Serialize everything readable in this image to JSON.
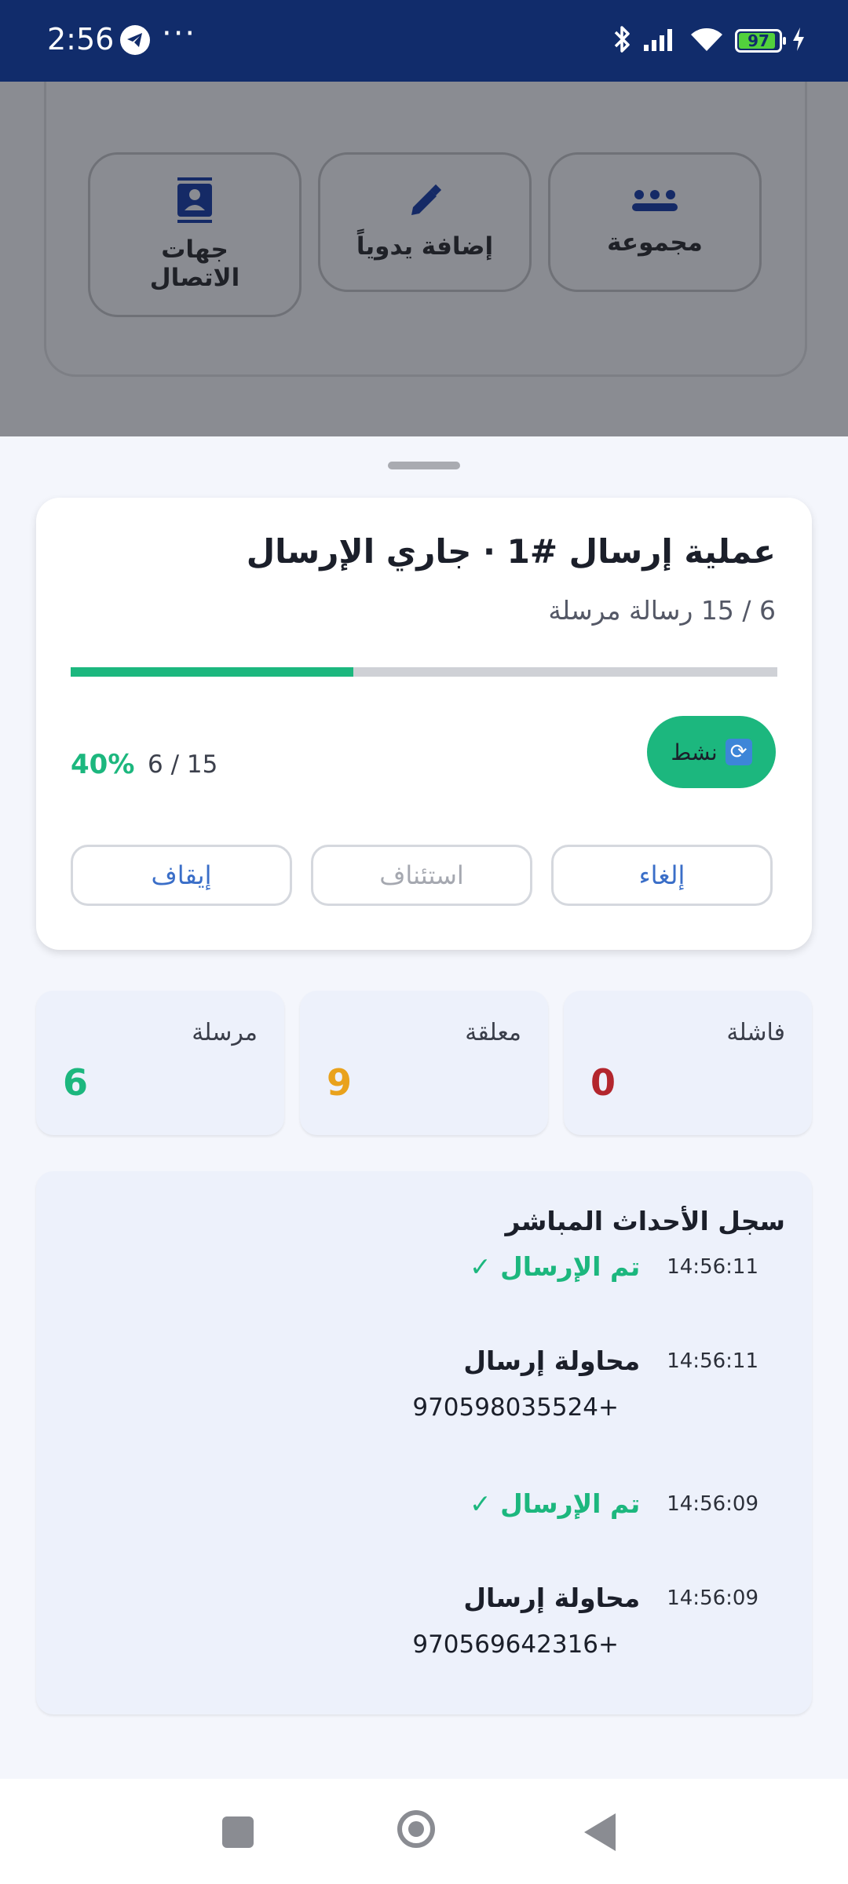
{
  "status_bar": {
    "time": "2:56",
    "more": "···",
    "battery_level": "97",
    "icons": [
      "telegram-icon",
      "bluetooth-icon",
      "signal-icon",
      "wifi-icon",
      "battery-icon",
      "charging-icon"
    ]
  },
  "background": {
    "buttons": [
      {
        "label": "مجموعة",
        "icon": "group-icon"
      },
      {
        "label": "إضافة يدوياً",
        "icon": "pencil-icon"
      },
      {
        "label": "جهات الاتصال",
        "icon": "contacts-icon"
      }
    ]
  },
  "operation": {
    "title": "عملية إرسال #1 · جاري الإرسال",
    "subtitle": "6 / 15 رسالة مرسلة",
    "progress_fraction": 0.4,
    "progress_percent": "40%",
    "progress_count": "6 / 15",
    "status_label": "نشط",
    "status_icon": "refresh-icon",
    "actions": {
      "cancel": "إلغاء",
      "resume": "استئناف",
      "stop": "إيقاف"
    }
  },
  "stats": [
    {
      "label": "فاشلة",
      "value": "0",
      "color": "#b3262d"
    },
    {
      "label": "معلقة",
      "value": "9",
      "color": "#e9a21c"
    },
    {
      "label": "مرسلة",
      "value": "6",
      "color": "#1cb77e"
    }
  ],
  "log": {
    "title": "سجل الأحداث المباشر",
    "entries": [
      {
        "time": "14:56:11",
        "message": "تم الإرسال ✓",
        "type": "success",
        "phone": ""
      },
      {
        "time": "14:56:11",
        "message": "محاولة إرسال",
        "type": "attempt",
        "phone": "970598035524+"
      },
      {
        "time": "14:56:09",
        "message": "تم الإرسال ✓",
        "type": "success",
        "phone": ""
      },
      {
        "time": "14:56:09",
        "message": "محاولة إرسال",
        "type": "attempt",
        "phone": "970569642316+"
      }
    ]
  },
  "colors": {
    "accent_green": "#1cb77e",
    "status_bar": "#112c6b",
    "action_text": "#3a6ec8"
  }
}
